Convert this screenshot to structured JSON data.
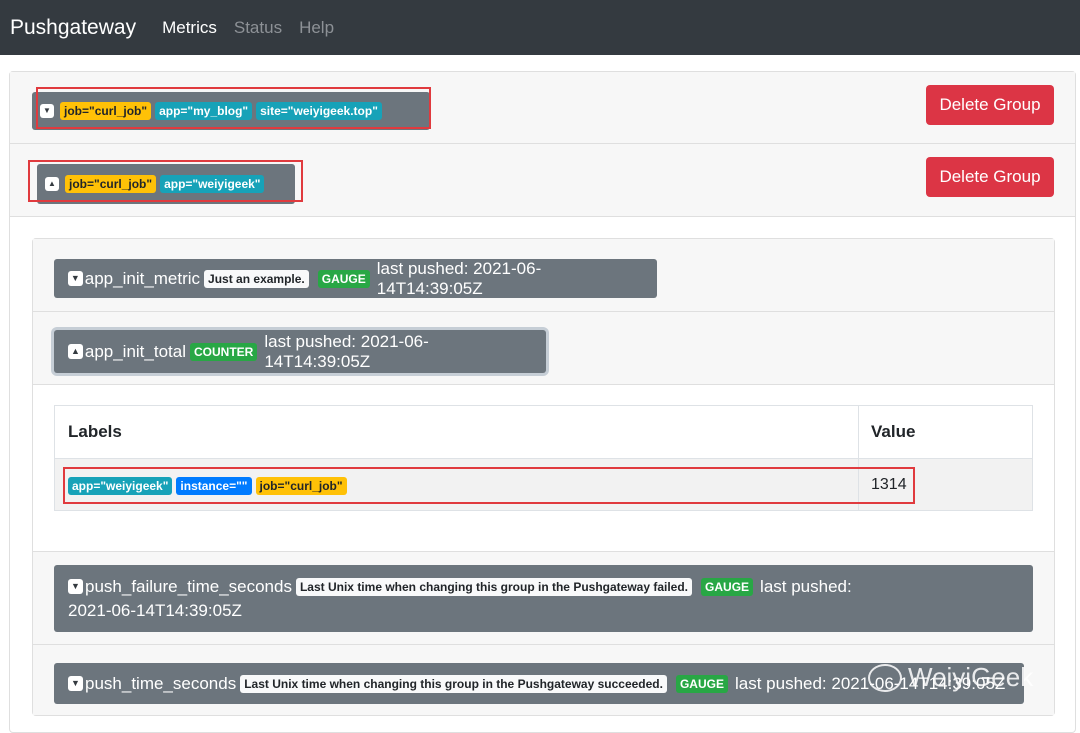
{
  "navbar": {
    "brand": "Pushgateway",
    "links": [
      "Metrics",
      "Status",
      "Help"
    ]
  },
  "groups": [
    {
      "labels": [
        {
          "text": "job=\"curl_job\"",
          "color": "#ffc107"
        },
        {
          "text": "app=\"my_blog\"",
          "color": "#17a2b8"
        },
        {
          "text": "site=\"weiyigeek.top\"",
          "color": "#17a2b8"
        }
      ],
      "delete_label": "Delete Group",
      "expanded": false
    },
    {
      "labels": [
        {
          "text": "job=\"curl_job\"",
          "color": "#ffc107"
        },
        {
          "text": "app=\"weiyigeek\"",
          "color": "#17a2b8"
        }
      ],
      "delete_label": "Delete Group",
      "expanded": true
    }
  ],
  "metrics": [
    {
      "name": "app_init_metric",
      "help": "Just an example.",
      "type": "GAUGE",
      "last_pushed": "last pushed: 2021-06-14T14:39:05Z"
    },
    {
      "name": "app_init_total",
      "type": "COUNTER",
      "last_pushed": "last pushed: 2021-06-14T14:39:05Z",
      "table": {
        "headers": [
          "Labels",
          "Value"
        ],
        "rows": [
          {
            "labels": [
              {
                "text": "app=\"weiyigeek\"",
                "color": "#17a2b8"
              },
              {
                "text": "instance=\"\"",
                "color": "#007bff"
              },
              {
                "text": "job=\"curl_job\"",
                "color": "#ffc107"
              }
            ],
            "value": "1314"
          }
        ]
      }
    },
    {
      "name": "push_failure_time_seconds",
      "help": "Last Unix time when changing this group in the Pushgateway failed.",
      "type": "GAUGE",
      "last_pushed_prefix": "last pushed:",
      "last_pushed_date": "2021-06-14T14:39:05Z"
    },
    {
      "name": "push_time_seconds",
      "help": "Last Unix time when changing this group in the Pushgateway succeeded.",
      "type": "GAUGE",
      "last_pushed": "last pushed: 2021-06-14T14:39:05Z"
    }
  ],
  "watermark": "WeiyiGeek",
  "colors": {
    "navbar": "#343a40",
    "danger": "#dc3545",
    "secondary": "#6c757d",
    "highlight": "#e03a3e"
  }
}
